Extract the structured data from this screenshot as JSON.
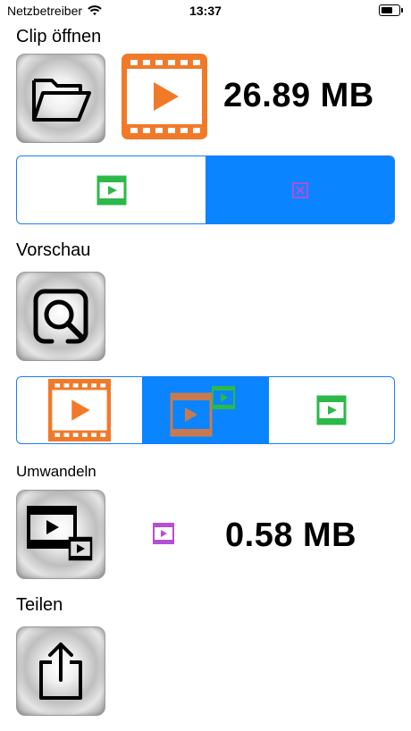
{
  "status_bar": {
    "carrier": "Netzbetreiber",
    "time": "13:37"
  },
  "sections": {
    "open": {
      "label": "Clip öffnen"
    },
    "preview": {
      "label": "Vorschau"
    },
    "convert": {
      "label": "Umwandeln"
    },
    "share": {
      "label": "Teilen"
    }
  },
  "clip": {
    "input_size": "26.89 MB",
    "output_size": "0.58 MB"
  },
  "icons": {
    "open": "folder-icon",
    "input_clip": "video-play-icon",
    "preview": "magnifier-icon",
    "convert": "video-convert-icon",
    "share": "share-icon",
    "output_clip": "small-video-icon"
  },
  "segmented_source": {
    "options": [
      "green-video-icon",
      "purple-compress-icon"
    ],
    "selected_index": 1
  },
  "segmented_preview": {
    "options": [
      "orange-video-icon",
      "orange-green-video-icon",
      "green-video-icon"
    ],
    "selected_index": 1
  },
  "colors": {
    "accent": "#0a84ff",
    "video_orange": "#f07a2a",
    "video_green": "#2db84a",
    "video_purple": "#b44fd6"
  }
}
